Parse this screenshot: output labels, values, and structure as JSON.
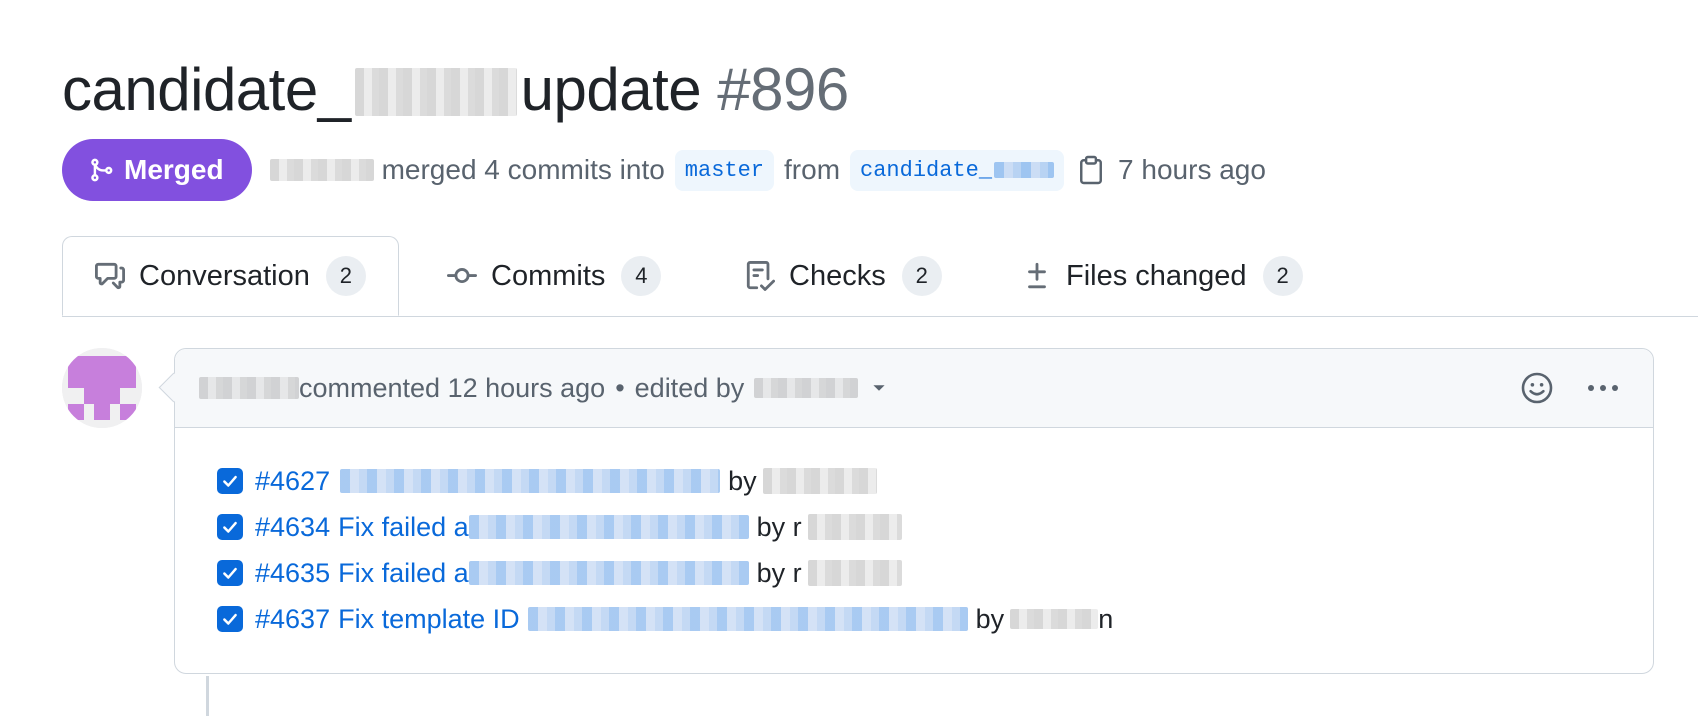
{
  "pr": {
    "title_prefix": "candidate_",
    "title_suffix": "update",
    "number": "#896"
  },
  "meta": {
    "status": "Merged",
    "merged_text": "merged 4 commits into",
    "base_branch": "master",
    "from_text": "from",
    "head_branch_prefix": "candidate_",
    "time": "7 hours ago",
    "icons": {
      "status": "git-merge-icon",
      "copy": "copy-icon"
    }
  },
  "tabs": [
    {
      "label": "Conversation",
      "count": "2",
      "icon": "comment-discussion-icon"
    },
    {
      "label": "Commits",
      "count": "4",
      "icon": "git-commit-icon"
    },
    {
      "label": "Checks",
      "count": "2",
      "icon": "checklist-icon"
    },
    {
      "label": "Files changed",
      "count": "2",
      "icon": "file-diff-icon"
    }
  ],
  "comment": {
    "header_text": "commented 12 hours ago",
    "separator": "•",
    "edited_text": "edited by",
    "tasks": [
      {
        "number": "#4627",
        "title": "",
        "by": "by",
        "author_tail": ""
      },
      {
        "number": "#4634",
        "title": "Fix failed a",
        "by": "by r",
        "author_tail": ""
      },
      {
        "number": "#4635",
        "title": "Fix failed a",
        "by": "by r",
        "author_tail": ""
      },
      {
        "number": "#4637",
        "title": "Fix template ID",
        "by": "by",
        "author_tail": "n"
      }
    ]
  },
  "colors": {
    "merged": "#8250df",
    "link": "#0969da",
    "avatar": "#c77fdc"
  }
}
